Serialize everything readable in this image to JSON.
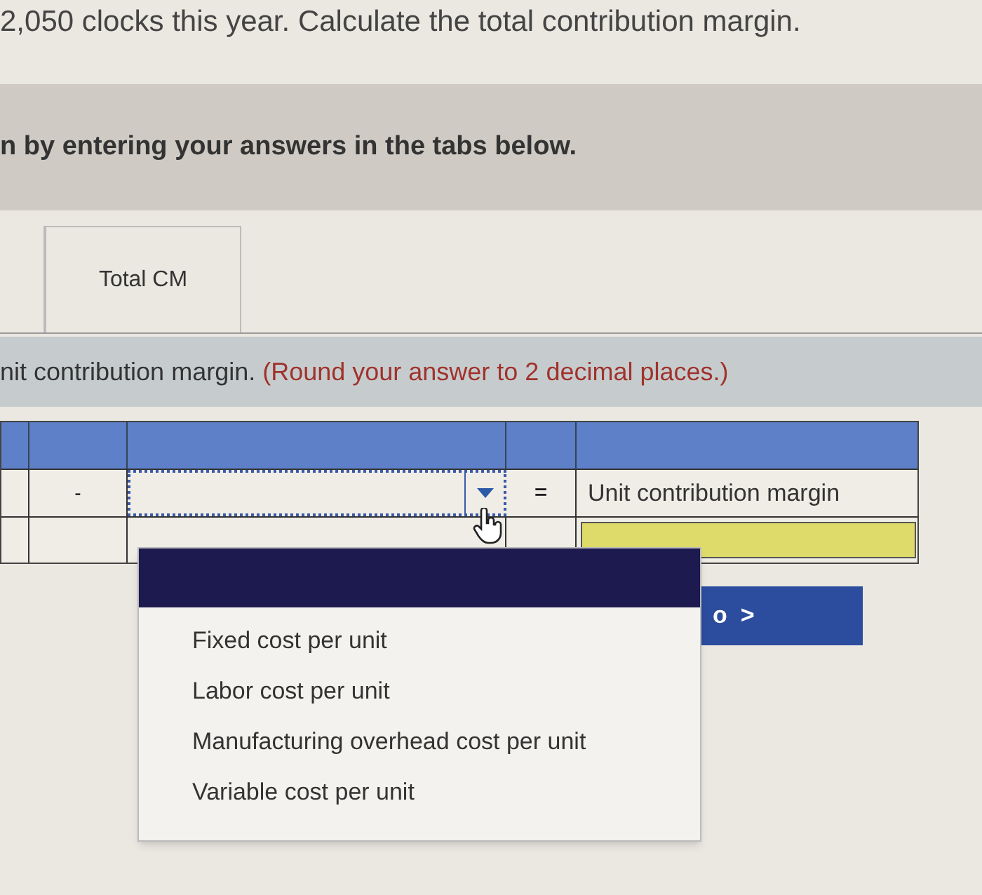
{
  "question_text": "2,050 clocks this year. Calculate the total contribution margin.",
  "instruction": "n by entering your answers in the tabs below.",
  "tabs": [
    {
      "label": "Total CM",
      "selected": false
    }
  ],
  "prompt": {
    "text": "nit contribution margin.",
    "note": "(Round your answer to 2 decimal places.)"
  },
  "table": {
    "operator_minus": "-",
    "operator_equals": "=",
    "result_label": "Unit contribution margin",
    "result_input_highlighted": true
  },
  "dropdown": {
    "expanded": true,
    "blank_option_selected": true,
    "options": [
      {
        "label": "Fixed cost per unit",
        "selected": false
      },
      {
        "label": "Labor cost per unit",
        "selected": false
      },
      {
        "label": "Manufacturing overhead cost per unit",
        "selected": false
      },
      {
        "label": "Variable cost per unit",
        "selected": false
      }
    ]
  },
  "next_button": {
    "label": "o  >"
  }
}
